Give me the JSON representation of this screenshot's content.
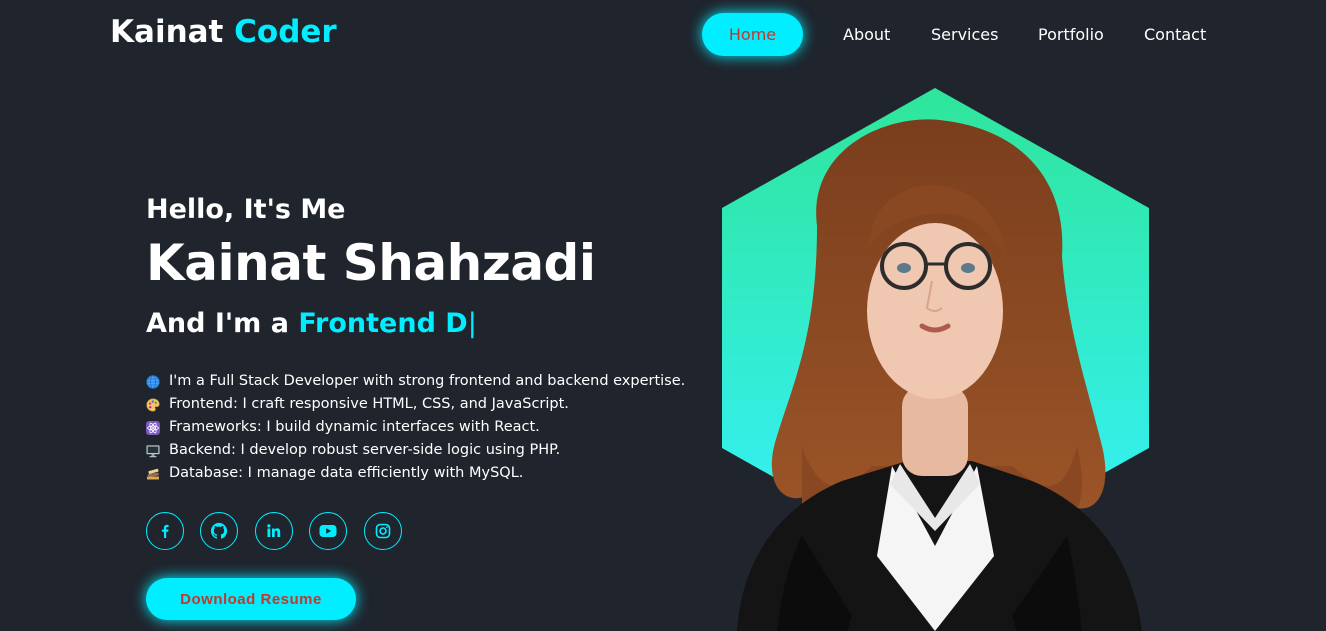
{
  "nav": {
    "logo_main": "Kainat",
    "logo_accent": "Coder",
    "links": [
      "Home",
      "About",
      "Services",
      "Portfolio",
      "Contact"
    ],
    "active_link": "Home"
  },
  "hero": {
    "greeting": "Hello, It's Me",
    "name": "Kainat Shahzadi",
    "role_prefix": "And I'm a",
    "role_typed": "Frontend D",
    "role_cursor": "|",
    "bio": [
      {
        "icon": "globe-icon",
        "text": "I'm a Full Stack Developer with strong frontend and backend expertise."
      },
      {
        "icon": "palette-icon",
        "text": "Frontend: I craft responsive HTML, CSS, and JavaScript."
      },
      {
        "icon": "react-atom-icon",
        "text": "Frameworks: I build dynamic interfaces with React."
      },
      {
        "icon": "desktop-computer-icon",
        "text": "Backend: I develop robust server-side logic using PHP."
      },
      {
        "icon": "books-icon",
        "text": "Database: I manage data efficiently with MySQL."
      }
    ],
    "socials": [
      "facebook-icon",
      "github-icon",
      "linkedin-icon",
      "youtube-icon",
      "instagram-icon"
    ],
    "resume_label": "Download Resume"
  },
  "colors": {
    "background": "#1f242d",
    "accent": "#00eeff",
    "button_text": "#c0392b",
    "hexagon_gradient": [
      "#2fe59a",
      "#35f2ff"
    ]
  }
}
